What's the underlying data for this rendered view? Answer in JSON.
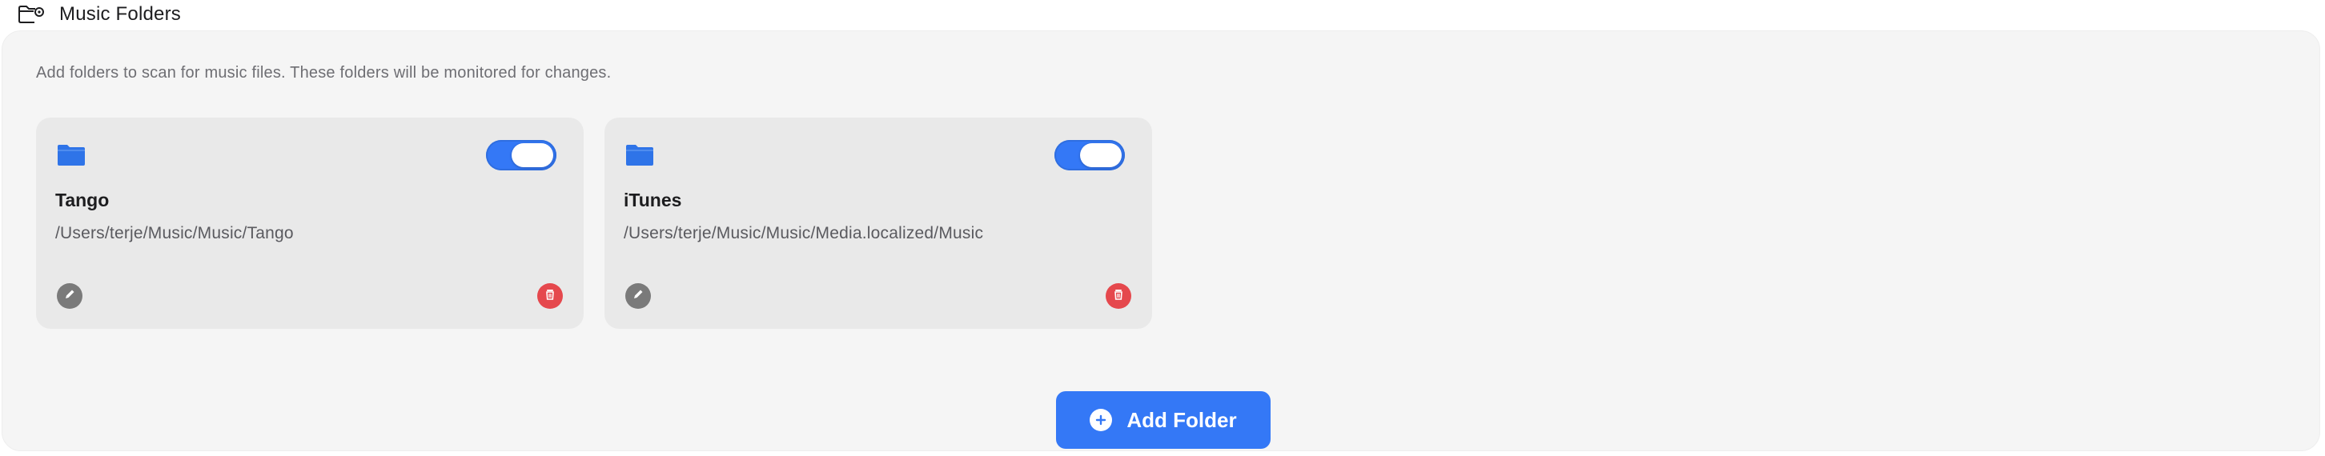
{
  "header": {
    "icon": "folder-settings-icon",
    "title": "Music Folders"
  },
  "description": "Add folders to scan for music files. These folders will be monitored for changes.",
  "colors": {
    "accent": "#3478f6",
    "danger": "#e5484d",
    "card_bg": "#e9e9e9",
    "panel_bg": "#f5f5f5"
  },
  "folders": [
    {
      "name": "Tango",
      "path": "/Users/terje/Music/Music/Tango",
      "enabled": true,
      "icon": "folder-icon"
    },
    {
      "name": "iTunes",
      "path": "/Users/terje/Music/Music/Media.localized/Music",
      "enabled": true,
      "icon": "folder-icon"
    }
  ],
  "add_button": {
    "label": "Add Folder",
    "icon": "plus-circle-icon"
  }
}
